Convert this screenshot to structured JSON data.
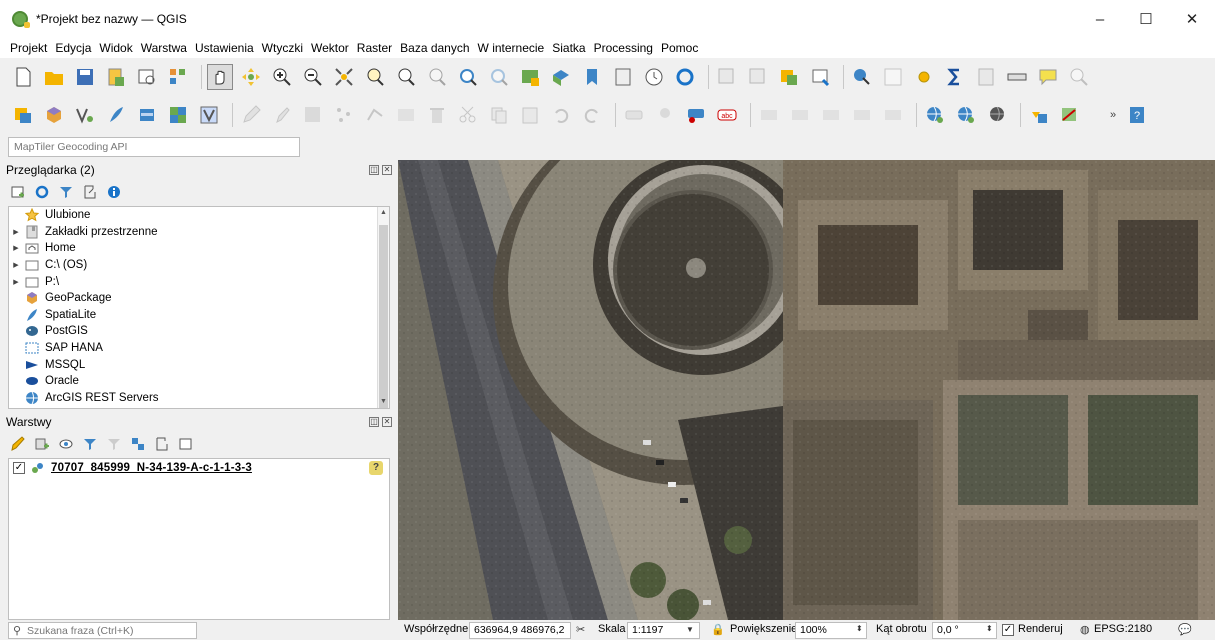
{
  "window": {
    "title": "*Projekt bez nazwy — QGIS",
    "minimize": "–",
    "maximize": "☐",
    "close": "✕"
  },
  "menubar": [
    "Projekt",
    "Edycja",
    "Widok",
    "Warstwa",
    "Ustawienia",
    "Wtyczki",
    "Wektor",
    "Raster",
    "Baza danych",
    "W internecie",
    "Siatka",
    "Processing",
    "Pomoc"
  ],
  "locator": {
    "value": "MapTiler Geocoding API"
  },
  "browser_panel": {
    "title": "Przeglądarka (2)",
    "items": [
      {
        "label": "Ulubione",
        "icon": "star-icon",
        "expandable": false
      },
      {
        "label": "Zakładki przestrzenne",
        "icon": "bookmarks-icon",
        "expandable": true
      },
      {
        "label": "Home",
        "icon": "home-folder-icon",
        "expandable": true
      },
      {
        "label": "C:\\ (OS)",
        "icon": "drive-icon",
        "expandable": true
      },
      {
        "label": "P:\\",
        "icon": "drive-icon",
        "expandable": true
      },
      {
        "label": "GeoPackage",
        "icon": "geopackage-icon",
        "expandable": false
      },
      {
        "label": "SpatiaLite",
        "icon": "spatialite-icon",
        "expandable": false
      },
      {
        "label": "PostGIS",
        "icon": "postgis-icon",
        "expandable": false
      },
      {
        "label": "SAP HANA",
        "icon": "sap-hana-icon",
        "expandable": false
      },
      {
        "label": "MSSQL",
        "icon": "mssql-icon",
        "expandable": false
      },
      {
        "label": "Oracle",
        "icon": "oracle-icon",
        "expandable": false
      },
      {
        "label": "ArcGIS REST Servers",
        "icon": "arcgis-icon",
        "expandable": false
      }
    ]
  },
  "layers_panel": {
    "title": "Warstwy",
    "layers": [
      {
        "name": "70707_845999_N-34-139-A-c-1-1-3-3",
        "checked": true,
        "icon": "raster-layer-icon"
      }
    ],
    "badge": "?"
  },
  "statusbar": {
    "search_placeholder": "Szukana fraza (Ctrl+K)",
    "coords_label": "Współrzędne",
    "coords_value": "636964,9 486976,2",
    "scale_label": "Skala",
    "scale_value": "1:1197",
    "magnifier_label": "Powiększenie",
    "magnifier_value": "100%",
    "rotation_label": "Kąt obrotu",
    "rotation_value": "0,0 °",
    "render_label": "Renderuj",
    "render_checked": true,
    "crs_label": "EPSG:2180"
  },
  "colors": {
    "accent": "#0078d7",
    "map_ground": "#7a7668"
  }
}
